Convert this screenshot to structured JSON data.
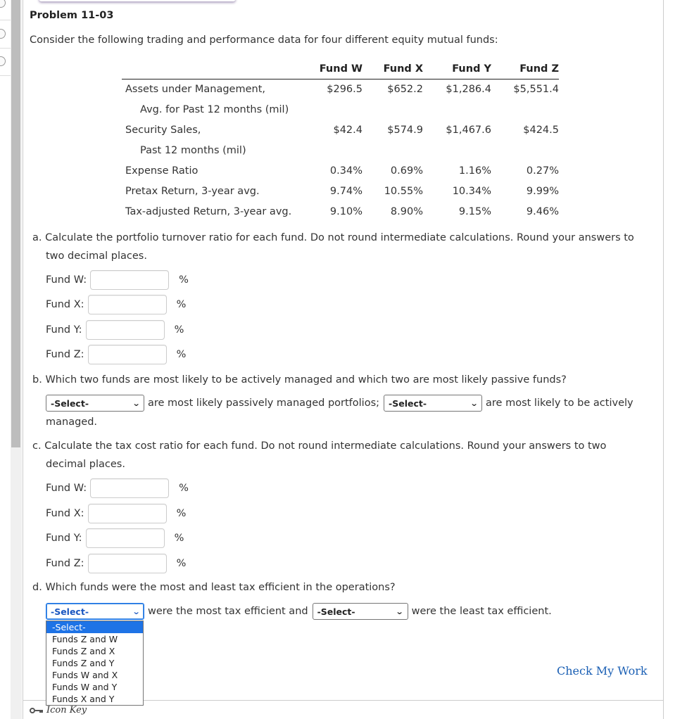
{
  "problem": {
    "title": "Problem 11-03",
    "intro": "Consider the following trading and performance data for four different equity mutual funds:"
  },
  "table": {
    "headers": [
      "",
      "Fund W",
      "Fund X",
      "Fund Y",
      "Fund Z"
    ],
    "rows": [
      {
        "label": "Assets under Management,",
        "values": [
          "$296.5",
          "$652.2",
          "$1,286.4",
          "$5,551.4"
        ]
      },
      {
        "label": "Avg. for Past 12 months (mil)",
        "values": [
          "",
          "",
          "",
          ""
        ]
      },
      {
        "label": "Security Sales,",
        "values": [
          "$42.4",
          "$574.9",
          "$1,467.6",
          "$424.5"
        ]
      },
      {
        "label": "Past 12 months (mil)",
        "values": [
          "",
          "",
          "",
          ""
        ]
      },
      {
        "label": "Expense Ratio",
        "values": [
          "0.34%",
          "0.69%",
          "1.16%",
          "0.27%"
        ]
      },
      {
        "label": "Pretax Return, 3-year avg.",
        "values": [
          "9.74%",
          "10.55%",
          "10.34%",
          "9.99%"
        ]
      },
      {
        "label": "Tax-adjusted Return, 3-year avg.",
        "values": [
          "9.10%",
          "8.90%",
          "9.15%",
          "9.46%"
        ]
      }
    ]
  },
  "part_a": {
    "prefix": "a. ",
    "line1": "Calculate the portfolio turnover ratio for each fund. Do not round intermediate calculations. Round your answers to",
    "line2": "two decimal places.",
    "fields": [
      {
        "label": "Fund W:",
        "value": "",
        "unit": "%"
      },
      {
        "label": "Fund X:",
        "value": "",
        "unit": "%"
      },
      {
        "label": "Fund Y:",
        "value": "",
        "unit": "%"
      },
      {
        "label": "Fund Z:",
        "value": "",
        "unit": "%"
      }
    ]
  },
  "part_b": {
    "prefix": "b. ",
    "question": "Which two funds are most likely to be actively managed and which two are most likely passive funds?",
    "select1": "-Select-",
    "text1": "are most likely passively managed portfolios;",
    "select2": "-Select-",
    "text2": "are most likely to be actively",
    "text3": "managed."
  },
  "part_c": {
    "prefix": "c. ",
    "line1": "Calculate the tax cost ratio for each fund. Do not round intermediate calculations. Round your answers to two",
    "line2": "decimal places.",
    "fields": [
      {
        "label": "Fund W:",
        "value": "",
        "unit": "%"
      },
      {
        "label": "Fund X:",
        "value": "",
        "unit": "%"
      },
      {
        "label": "Fund Y:",
        "value": "",
        "unit": "%"
      },
      {
        "label": "Fund Z:",
        "value": "",
        "unit": "%"
      }
    ]
  },
  "part_d": {
    "prefix": "d. ",
    "question": "Which funds were the most and least tax efficient in the operations?",
    "select1": "-Select-",
    "text1": "were the most tax efficient and",
    "select2": "-Select-",
    "text2": "were the least tax efficient.",
    "dropdown_options": [
      "-Select-",
      "Funds Z and W",
      "Funds Z and X",
      "Funds Z and Y",
      "Funds W and X",
      "Funds W and Y",
      "Funds X and Y"
    ],
    "dropdown_selected": "-Select-"
  },
  "footer": {
    "check_my_work": "Check My Work",
    "icon_key": "Icon Key"
  },
  "colors": {
    "link": "#1a5fb4",
    "dropdown_highlight": "#1e73e6",
    "focus": "#1a73e8"
  }
}
